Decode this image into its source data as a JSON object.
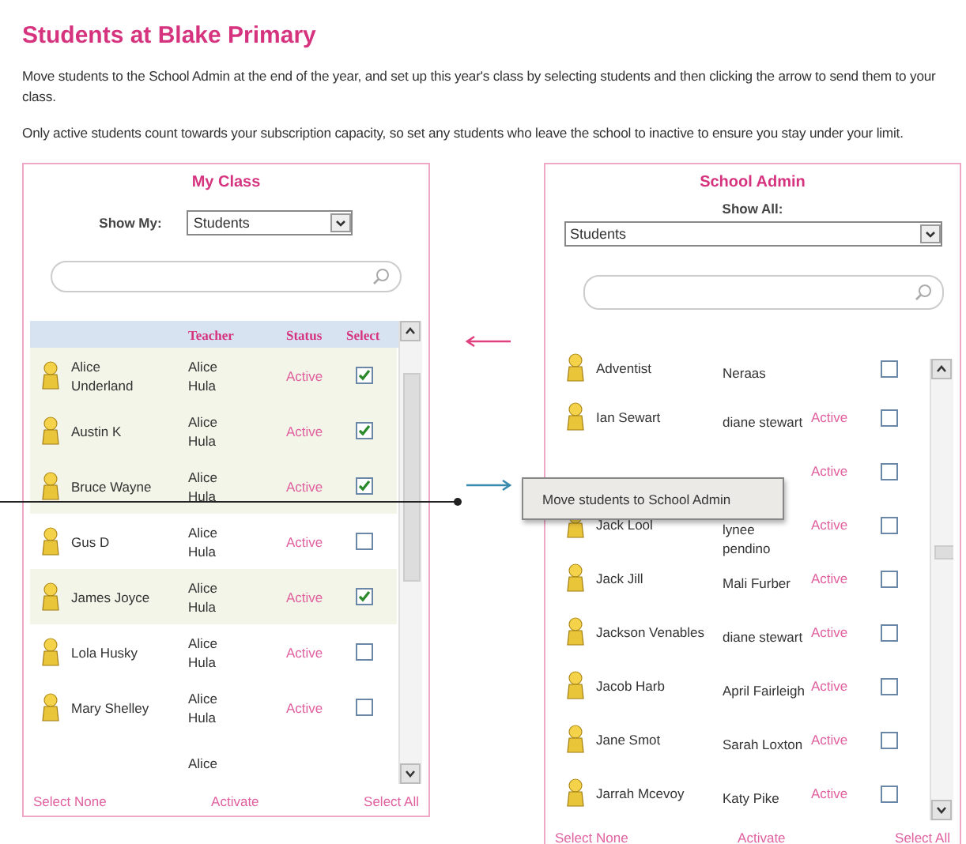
{
  "title": "Students at Blake Primary",
  "intro": [
    "Move students to the School Admin at the end of the year, and set up this year's class by selecting students and then clicking the arrow to send them to your class.",
    "Only active students count towards your subscription capacity, so set any students who leave the school to inactive to ensure you stay under your limit."
  ],
  "my_class": {
    "title": "My Class",
    "show_label": "Show My:",
    "show_value": "Students",
    "columns": [
      "Teacher",
      "Status",
      "Select"
    ],
    "rows": [
      {
        "name": "Alice Underland",
        "teacher": "Alice Hula",
        "status": "Active",
        "checked": true
      },
      {
        "name": "Austin K",
        "teacher": "Alice Hula",
        "status": "Active",
        "checked": true
      },
      {
        "name": "Bruce Wayne",
        "teacher": "Alice Hula",
        "status": "Active",
        "checked": true
      },
      {
        "name": "Gus D",
        "teacher": "Alice Hula",
        "status": "Active",
        "checked": false
      },
      {
        "name": "James Joyce",
        "teacher": "Alice Hula",
        "status": "Active",
        "checked": true
      },
      {
        "name": "Lola Husky",
        "teacher": "Alice Hula",
        "status": "Active",
        "checked": false
      },
      {
        "name": "Mary Shelley",
        "teacher": "Alice Hula",
        "status": "Active",
        "checked": false
      },
      {
        "teacher": "Alice"
      }
    ],
    "actions": [
      "Select None",
      "Activate",
      "Select All"
    ]
  },
  "school_admin": {
    "title": "School Admin",
    "show_label": "Show All:",
    "show_value": "Students",
    "rows": [
      {
        "name": "Adventist",
        "teacher": "Neraas",
        "checked": false
      },
      {
        "name": "Ian Sewart",
        "teacher": "diane stewart",
        "status": "Active",
        "checked": false
      },
      {
        "status": "Active",
        "checked": false
      },
      {
        "name": "Jack Lool",
        "teacher": "lynee pendino",
        "status": "Active",
        "checked": false
      },
      {
        "name": "Jack Jill",
        "teacher": "Mali Furber",
        "status": "Active",
        "checked": false
      },
      {
        "name": "Jackson Venables",
        "teacher": "diane stewart",
        "status": "Active",
        "checked": false
      },
      {
        "name": "Jacob Harb",
        "teacher": "April Fairleigh",
        "status": "Active",
        "checked": false
      },
      {
        "name": "Jane Smot",
        "teacher": "Sarah Loxton",
        "status": "Active",
        "checked": false
      },
      {
        "name": "Jarrah Mcevoy",
        "teacher": "Katy Pike",
        "status": "Active",
        "checked": false
      }
    ],
    "actions": [
      "Select None",
      "Activate",
      "Select All"
    ]
  },
  "tooltip": "Move students to School Admin"
}
